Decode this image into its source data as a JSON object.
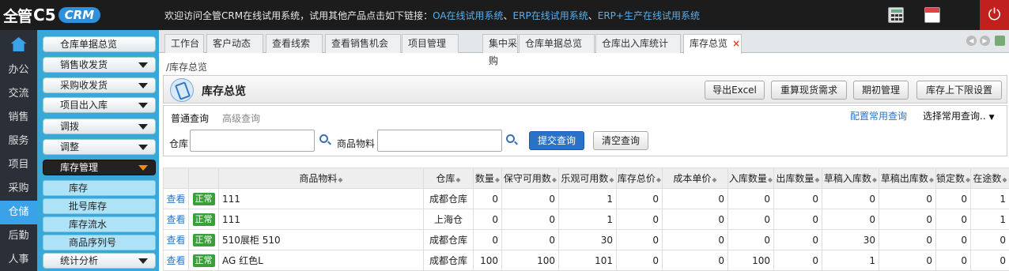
{
  "header": {
    "logo_text": "全管",
    "logo_c5": "C5",
    "logo_crm": "CRM",
    "welcome": "欢迎访问全管CRM在线试用系统，试用其他产品点击如下链接：",
    "links": [
      "OA在线试用系统",
      "ERP在线试用系统",
      "ERP+生产在线试用系统"
    ],
    "separator": "、"
  },
  "icons": {
    "calculator": "calculator-icon",
    "calendar": "calendar-icon",
    "power": "power-icon",
    "home": "home-icon"
  },
  "leftnav": [
    "办公",
    "交流",
    "销售",
    "服务",
    "项目",
    "采购",
    "仓储",
    "后勤",
    "人事"
  ],
  "leftnav_active": "仓储",
  "submenu": {
    "items": [
      {
        "label": "仓库单据总览",
        "arrow": false
      },
      {
        "label": "销售收发货",
        "arrow": true
      },
      {
        "label": "采购收发货",
        "arrow": true
      },
      {
        "label": "项目出入库",
        "arrow": true
      },
      {
        "label": "调拨",
        "arrow": true
      },
      {
        "label": "调整",
        "arrow": true
      },
      {
        "label": "库存管理",
        "arrow": true,
        "active": true
      }
    ],
    "subitems": [
      "库存",
      "批号库存",
      "库存流水",
      "商品序列号"
    ],
    "footer": "统计分析"
  },
  "tabs": [
    "工作台",
    "客户动态",
    "查看线索",
    "查看销售机会",
    "项目管理",
    "集中采购",
    "仓库单据总览",
    "仓库出入库统计",
    "库存总览"
  ],
  "active_tab": "库存总览",
  "breadcrumb": "/库存总览",
  "page_title": "库存总览",
  "actions": [
    "导出Excel",
    "重算现货需求",
    "期初管理",
    "库存上下限设置"
  ],
  "query": {
    "tab_normal": "普通查询",
    "tab_advanced": "高级查询",
    "config_link": "配置常用查询",
    "select_text": "选择常用查询..",
    "warehouse_label": "仓库",
    "warehouse_value": "",
    "product_label": "商品物料",
    "product_value": "",
    "submit": "提交查询",
    "clear": "清空查询"
  },
  "table": {
    "headers": [
      "",
      "",
      "商品物料",
      "仓库",
      "数量",
      "保守可用数",
      "乐观可用数",
      "库存总价",
      "成本单价",
      "入库数量",
      "出库数量",
      "草稿入库数",
      "草稿出库数",
      "锁定数",
      "在途数"
    ],
    "rows": [
      {
        "view": "查看",
        "status": "正常",
        "product": "111",
        "warehouse": "成都仓库",
        "vals": [
          "0",
          "0",
          "1",
          "0",
          "0",
          "0",
          "0",
          "0",
          "0",
          "0",
          "1"
        ]
      },
      {
        "view": "查看",
        "status": "正常",
        "product": "111",
        "warehouse": "上海仓",
        "vals": [
          "0",
          "0",
          "1",
          "0",
          "0",
          "0",
          "0",
          "0",
          "0",
          "0",
          "1"
        ]
      },
      {
        "view": "查看",
        "status": "正常",
        "product": "510展柜 510",
        "warehouse": "成都仓库",
        "vals": [
          "0",
          "0",
          "30",
          "0",
          "0",
          "0",
          "0",
          "30",
          "0",
          "0",
          "0"
        ]
      },
      {
        "view": "查看",
        "status": "正常",
        "product": "AG 红色L",
        "warehouse": "成都仓库",
        "vals": [
          "100",
          "100",
          "101",
          "0",
          "0",
          "100",
          "0",
          "1",
          "0",
          "0",
          "0"
        ]
      }
    ]
  }
}
